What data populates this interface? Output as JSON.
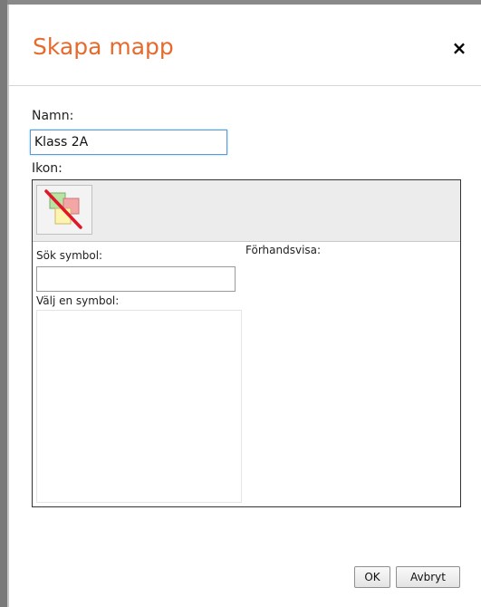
{
  "dialog": {
    "title": "Skapa mapp",
    "close_symbol": "×"
  },
  "form": {
    "name_label": "Namn:",
    "name_value": "Klass 2A",
    "icon_label": "Ikon:"
  },
  "icon_picker": {
    "current_icon": "no-icon-folder-icon",
    "search_label": "Sök symbol:",
    "search_value": "",
    "choose_label": "Välj en symbol:",
    "preview_label": "Förhandsvisa:",
    "symbols": []
  },
  "buttons": {
    "ok_label": "OK",
    "cancel_label": "Avbryt"
  },
  "colors": {
    "title": "#e56a2c",
    "focus_border": "#5b9bd5",
    "no_icon_slash": "#e0162b"
  }
}
